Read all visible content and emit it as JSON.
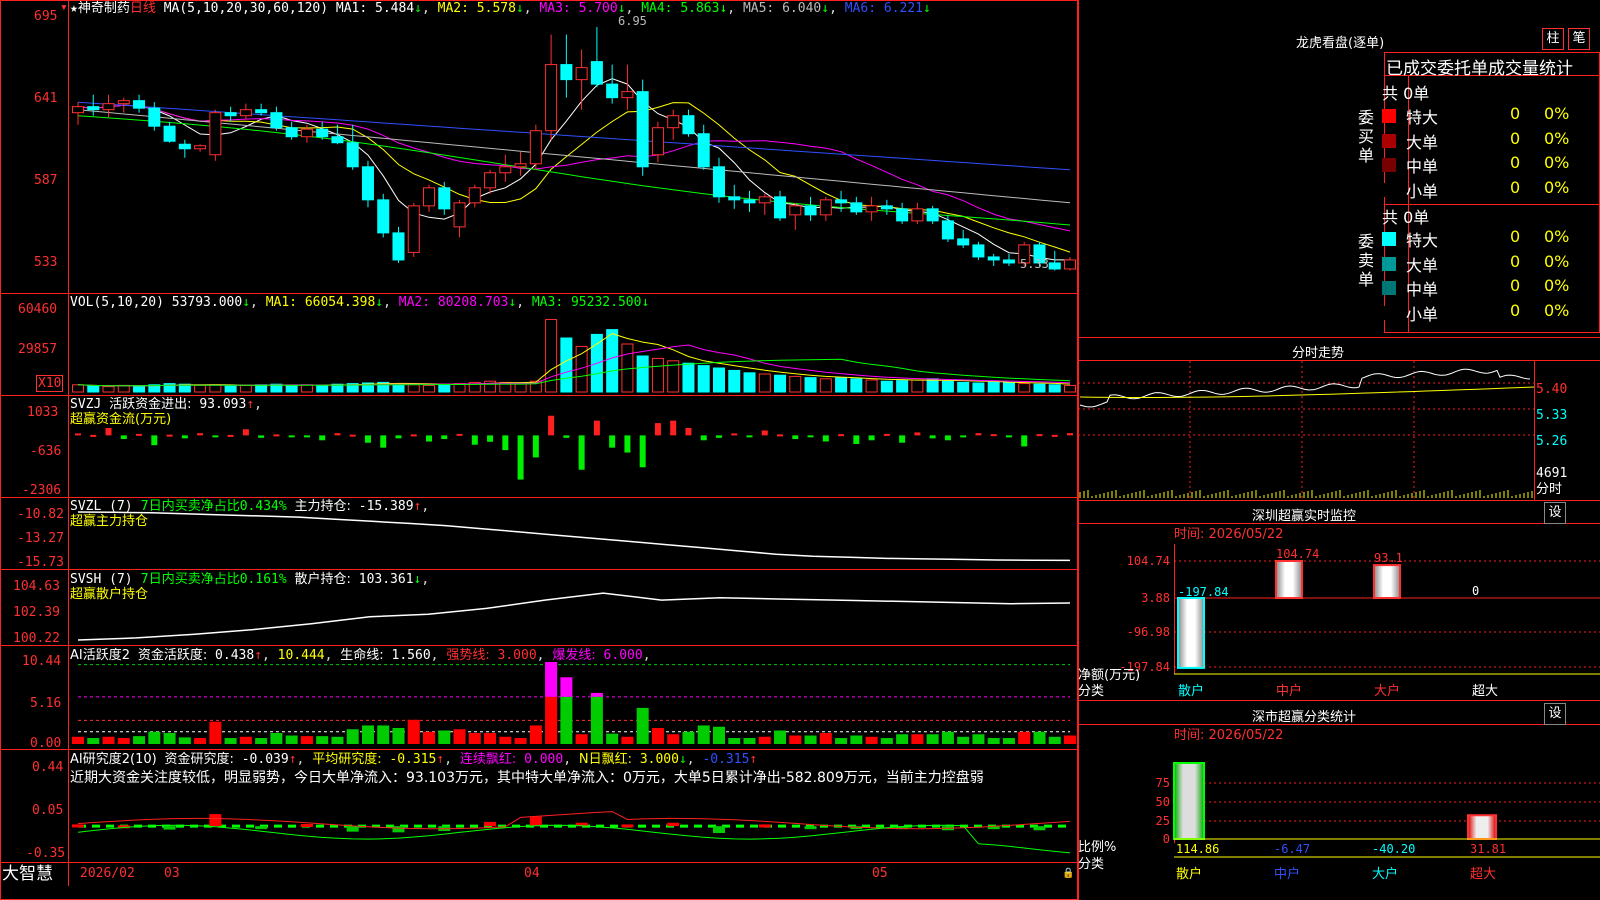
{
  "app": {
    "brand": "大智慧"
  },
  "price": {
    "title_star": "★",
    "stock_name": "神奇制药",
    "period": "日线",
    "ma_params": "MA(5,10,20,30,60,120)",
    "ma": [
      {
        "label": "MA1:",
        "value": "5.484",
        "arrow": "↓",
        "color": "#ffffff"
      },
      {
        "label": "MA2:",
        "value": "5.578",
        "arrow": "↓",
        "color": "#ffff00"
      },
      {
        "label": "MA3:",
        "value": "5.700",
        "arrow": "↓",
        "color": "#ff00ff"
      },
      {
        "label": "MA4:",
        "value": "5.863",
        "arrow": "↓",
        "color": "#00ff00"
      },
      {
        "label": "MA5:",
        "value": "6.040",
        "arrow": "↓",
        "color": "#bbbbbb"
      },
      {
        "label": "MA6:",
        "value": "6.221",
        "arrow": "↓",
        "color": "#3050ff"
      }
    ],
    "y_ticks": [
      "695",
      "641",
      "587",
      "533"
    ],
    "high_label": "6.95",
    "low_label": "5.33"
  },
  "vol": {
    "header": "VOL(5,10,20)",
    "value": "53793.000",
    "ma": [
      {
        "label": "MA1:",
        "value": "66054.398",
        "arrow": "↓",
        "color": "#ffff00"
      },
      {
        "label": "MA2:",
        "value": "80208.703",
        "arrow": "↓",
        "color": "#ff00ff"
      },
      {
        "label": "MA3:",
        "value": "95232.500",
        "arrow": "↓",
        "color": "#00ff00"
      }
    ],
    "y_ticks": [
      "60460",
      "29857"
    ],
    "unit": "X10"
  },
  "svzj": {
    "name": "SVZJ",
    "label": "活跃资金进出:",
    "value": "93.093",
    "arrow": "↑",
    "subtitle": "超赢资金流(万元)",
    "y_ticks": [
      "1033",
      "-636",
      "-2306"
    ]
  },
  "svzl": {
    "name": "SVZL (7)",
    "ratio_label": "7日内买卖净占比",
    "ratio": "0.434%",
    "hold_label": "主力持仓:",
    "hold": "-15.389",
    "arrow": "↑",
    "subtitle": "超赢主力持仓",
    "y_ticks": [
      "-10.82",
      "-13.27",
      "-15.73"
    ]
  },
  "svsh": {
    "name": "SVSH (7)",
    "ratio_label": "7日内买卖净占比",
    "ratio": "0.161%",
    "hold_label": "散户持仓:",
    "hold": "103.361",
    "arrow": "↓",
    "subtitle": "超赢散户持仓",
    "y_ticks": [
      "104.63",
      "102.39",
      "100.22"
    ]
  },
  "ai1": {
    "name": "AI活跃度2",
    "l1": "资金活跃度:",
    "v1": "0.438",
    "a1": "↑",
    "v2": "10.444",
    "l3": "生命线:",
    "v3": "1.560",
    "l4": "强势线:",
    "v4": "3.000",
    "l5": "爆发线:",
    "v5": "6.000",
    "y_ticks": [
      "10.44",
      "5.16",
      "0.00"
    ]
  },
  "ai2": {
    "name": "AI研究度2(10)",
    "l1": "资金研究度:",
    "v1": "-0.039",
    "a1": "↑",
    "l2": "平均研究度:",
    "v2": "-0.315",
    "a2": "↑",
    "l3": "连续飘红:",
    "v3": "0.000",
    "l4": "N日飘红:",
    "v4": "3.000",
    "a4": "↓",
    "v5": "-0.315",
    "a5": "↑",
    "comment": "近期大资金关注度较低，明显弱势，今日大单净流入：93.103万元，其中特大单净流入：0万元，大单5日累计净出-582.809万元，当前主力控盘弱",
    "y_ticks": [
      "0.44",
      "0.05",
      "-0.35"
    ]
  },
  "xaxis": {
    "labels": [
      "2026/02",
      "03",
      "04",
      "05"
    ]
  },
  "dragon": {
    "title": "龙虎看盘(逐单)",
    "btn1": "柱",
    "btn2": "笔",
    "stats_title": "已成交委托单成交量统计",
    "buy_side": "委买单",
    "sell_side": "委卖单",
    "buy_total": "共 0单",
    "sell_total": "共 0单",
    "buy_rows": [
      {
        "name": "特大",
        "vol": "0",
        "pct": "0%",
        "color": "#ff0000"
      },
      {
        "name": "大单",
        "vol": "0",
        "pct": "0%",
        "color": "#aa0000"
      },
      {
        "name": "中单",
        "vol": "0",
        "pct": "0%",
        "color": "#770000"
      },
      {
        "name": "小单",
        "vol": "0",
        "pct": "0%",
        "color": "#000000"
      }
    ],
    "sell_rows": [
      {
        "name": "特大",
        "vol": "0",
        "pct": "0%",
        "color": "#00ffff"
      },
      {
        "name": "大单",
        "vol": "0",
        "pct": "0%",
        "color": "#009999"
      },
      {
        "name": "中单",
        "vol": "0",
        "pct": "0%",
        "color": "#007777"
      },
      {
        "name": "小单",
        "vol": "0",
        "pct": "0%",
        "color": "#000000"
      }
    ]
  },
  "intraday": {
    "title": "分时走势",
    "y_ticks": [
      "5.40",
      "5.33",
      "5.26"
    ],
    "vol_tick": "4691",
    "vol_unit": "分时"
  },
  "monitor": {
    "title": "深圳超赢实时监控",
    "btn": "设",
    "time": "时间: 2026/05/22",
    "y_ticks": [
      "104.74",
      "3.88",
      "-96.98",
      "-197.84"
    ],
    "ylabel": "净额(万元)",
    "xlabel": "分类",
    "categories": [
      "散户",
      "中户",
      "大户",
      "超大"
    ],
    "values_text": [
      "-197.84",
      "104.74",
      "93.1",
      "0"
    ]
  },
  "classify": {
    "title": "深市超赢分类统计",
    "btn": "设",
    "time": "时间: 2026/05/22",
    "y_ticks": [
      "75",
      "50",
      "25",
      "0"
    ],
    "ylabel": "比例%",
    "xlabel": "分类",
    "categories": [
      "散户",
      "中户",
      "大户",
      "超大"
    ],
    "values_text": [
      "114.86",
      "-6.47",
      "-40.20",
      "31.81"
    ]
  },
  "chart_data": [
    {
      "type": "candlestick",
      "title": "神奇制药 日线",
      "ylim": [
        5.2,
        7.05
      ],
      "x": [
        "2026/02",
        "03",
        "04",
        "05"
      ],
      "ohlc": [
        [
          6.38,
          6.45,
          6.3,
          6.42
        ],
        [
          6.42,
          6.5,
          6.36,
          6.4
        ],
        [
          6.4,
          6.5,
          6.35,
          6.44
        ],
        [
          6.44,
          6.48,
          6.38,
          6.46
        ],
        [
          6.46,
          6.5,
          6.38,
          6.41
        ],
        [
          6.41,
          6.45,
          6.26,
          6.29
        ],
        [
          6.29,
          6.32,
          6.18,
          6.19
        ],
        [
          6.17,
          6.2,
          6.08,
          6.14
        ],
        [
          6.14,
          6.17,
          6.12,
          6.16
        ],
        [
          6.1,
          6.4,
          6.06,
          6.38
        ],
        [
          6.38,
          6.42,
          6.32,
          6.36
        ],
        [
          6.36,
          6.44,
          6.34,
          6.4
        ],
        [
          6.4,
          6.44,
          6.36,
          6.38
        ],
        [
          6.38,
          6.42,
          6.26,
          6.28
        ],
        [
          6.28,
          6.32,
          6.2,
          6.22
        ],
        [
          6.22,
          6.3,
          6.18,
          6.27
        ],
        [
          6.27,
          6.32,
          6.2,
          6.22
        ],
        [
          6.22,
          6.3,
          6.17,
          6.18
        ],
        [
          6.18,
          6.3,
          6.0,
          6.02
        ],
        [
          6.02,
          6.06,
          5.75,
          5.8
        ],
        [
          5.8,
          5.84,
          5.55,
          5.58
        ],
        [
          5.58,
          5.62,
          5.38,
          5.4
        ],
        [
          5.45,
          5.78,
          5.42,
          5.76
        ],
        [
          5.76,
          5.9,
          5.72,
          5.88
        ],
        [
          5.88,
          5.92,
          5.7,
          5.74
        ],
        [
          5.62,
          5.8,
          5.55,
          5.78
        ],
        [
          5.78,
          5.9,
          5.75,
          5.88
        ],
        [
          5.88,
          6.0,
          5.84,
          5.98
        ],
        [
          5.98,
          6.1,
          5.92,
          6.02
        ],
        [
          6.02,
          6.12,
          5.96,
          6.04
        ],
        [
          6.04,
          6.3,
          6.0,
          6.26
        ],
        [
          6.26,
          6.9,
          6.2,
          6.7
        ],
        [
          6.7,
          6.9,
          6.48,
          6.6
        ],
        [
          6.6,
          6.8,
          6.4,
          6.68
        ],
        [
          6.72,
          6.95,
          6.55,
          6.57
        ],
        [
          6.57,
          6.7,
          6.44,
          6.48
        ],
        [
          6.48,
          6.7,
          6.4,
          6.52
        ],
        [
          6.52,
          6.6,
          5.96,
          6.02
        ],
        [
          6.1,
          6.32,
          6.05,
          6.28
        ],
        [
          6.28,
          6.4,
          6.2,
          6.36
        ],
        [
          6.36,
          6.4,
          6.22,
          6.24
        ],
        [
          6.24,
          6.3,
          6.0,
          6.02
        ],
        [
          6.02,
          6.08,
          5.78,
          5.82
        ],
        [
          5.82,
          5.9,
          5.74,
          5.8
        ],
        [
          5.8,
          5.86,
          5.72,
          5.78
        ],
        [
          5.78,
          5.84,
          5.7,
          5.82
        ],
        [
          5.82,
          5.86,
          5.66,
          5.68
        ],
        [
          5.7,
          5.78,
          5.6,
          5.76
        ],
        [
          5.76,
          5.82,
          5.66,
          5.7
        ],
        [
          5.7,
          5.82,
          5.66,
          5.8
        ],
        [
          5.8,
          5.86,
          5.72,
          5.78
        ],
        [
          5.78,
          5.82,
          5.7,
          5.72
        ],
        [
          5.72,
          5.82,
          5.66,
          5.76
        ],
        [
          5.76,
          5.8,
          5.7,
          5.74
        ],
        [
          5.74,
          5.78,
          5.64,
          5.66
        ],
        [
          5.66,
          5.78,
          5.64,
          5.74
        ],
        [
          5.74,
          5.76,
          5.64,
          5.66
        ],
        [
          5.66,
          5.7,
          5.52,
          5.54
        ],
        [
          5.54,
          5.6,
          5.48,
          5.5
        ],
        [
          5.5,
          5.52,
          5.4,
          5.42
        ],
        [
          5.42,
          5.44,
          5.36,
          5.4
        ],
        [
          5.4,
          5.44,
          5.36,
          5.38
        ],
        [
          5.38,
          5.52,
          5.36,
          5.5
        ],
        [
          5.5,
          5.52,
          5.36,
          5.38
        ],
        [
          5.38,
          5.46,
          5.33,
          5.34
        ],
        [
          5.34,
          5.42,
          5.33,
          5.4
        ]
      ],
      "series": [
        {
          "name": "MA1",
          "values": [
            5.484
          ]
        },
        {
          "name": "MA2",
          "values": [
            5.578
          ]
        },
        {
          "name": "MA3",
          "values": [
            5.7
          ]
        },
        {
          "name": "MA4",
          "values": [
            5.863
          ]
        },
        {
          "name": "MA5",
          "values": [
            6.04
          ]
        },
        {
          "name": "MA6",
          "values": [
            6.221
          ]
        }
      ]
    },
    {
      "type": "bar",
      "title": "VOL(5,10,20)",
      "ylim": [
        0,
        70000
      ],
      "values": [
        6000,
        5000,
        4500,
        5500,
        5000,
        6000,
        7000,
        6500,
        5500,
        6000,
        5000,
        5500,
        6000,
        6500,
        5000,
        6000,
        5500,
        6500,
        7000,
        7500,
        8000,
        7000,
        6000,
        5500,
        6500,
        7000,
        8000,
        9000,
        8000,
        7000,
        9000,
        60460,
        45000,
        38000,
        48000,
        52000,
        40000,
        30000,
        28000,
        26000,
        24000,
        22000,
        20000,
        18000,
        16000,
        15000,
        14000,
        13000,
        12000,
        11000,
        12000,
        11000,
        10000,
        9000,
        9500,
        10000,
        11000,
        9000,
        8000,
        7500,
        8500,
        8000,
        7000,
        6500,
        6000,
        5379
      ]
    },
    {
      "type": "bar",
      "title": "超赢资金流(万元)",
      "ylim": [
        -2306,
        1033
      ],
      "values": [
        80,
        20,
        300,
        -150,
        60,
        -400,
        30,
        -120,
        90,
        -60,
        20,
        250,
        -100,
        40,
        -80,
        -60,
        -200,
        90,
        30,
        -300,
        -500,
        -120,
        40,
        -250,
        -150,
        60,
        -380,
        -260,
        -600,
        -1800,
        -900,
        800,
        -100,
        -1400,
        600,
        -500,
        -700,
        -1300,
        500,
        600,
        300,
        -200,
        -100,
        80,
        -80,
        200,
        40,
        -150,
        -60,
        -250,
        50,
        -350,
        -200,
        60,
        -300,
        120,
        -120,
        -200,
        -80,
        90,
        50,
        -50,
        -450,
        50,
        20,
        93
      ]
    },
    {
      "type": "line",
      "title": "SVZL",
      "ylim": [
        -15.73,
        -10.82
      ],
      "values": [
        -10.82,
        -10.85,
        -10.9,
        -11.0,
        -11.1,
        -11.2,
        -11.3,
        -11.5,
        -11.7,
        -11.9,
        -12.1,
        -12.4,
        -12.7,
        -13.0,
        -13.3,
        -13.6,
        -13.9,
        -14.2,
        -14.5,
        -14.8,
        -15.0,
        -15.1,
        -15.2,
        -15.25,
        -15.3,
        -15.35,
        -15.38,
        -15.389
      ]
    },
    {
      "type": "line",
      "title": "SVSH",
      "ylim": [
        100.22,
        104.63
      ],
      "values": [
        100.22,
        100.4,
        100.7,
        101.1,
        101.6,
        102.2,
        102.4,
        102.9,
        103.6,
        104.2,
        103.6,
        103.8,
        103.7,
        103.6,
        103.5,
        103.4,
        103.3,
        103.361
      ]
    },
    {
      "type": "bar",
      "title": "AI活跃度2",
      "ylim": [
        0,
        10.44
      ],
      "series": [
        {
          "name": "强势线",
          "values": [
            3.0
          ]
        },
        {
          "name": "爆发线",
          "values": [
            6.0
          ]
        }
      ]
    },
    {
      "type": "bar",
      "title": "AI研究度2(10)",
      "ylim": [
        -0.35,
        0.44
      ],
      "series": [
        {
          "name": "资金研究度",
          "values": [
            -0.039
          ]
        },
        {
          "name": "平均研究度",
          "values": [
            -0.315
          ]
        }
      ]
    }
  ]
}
